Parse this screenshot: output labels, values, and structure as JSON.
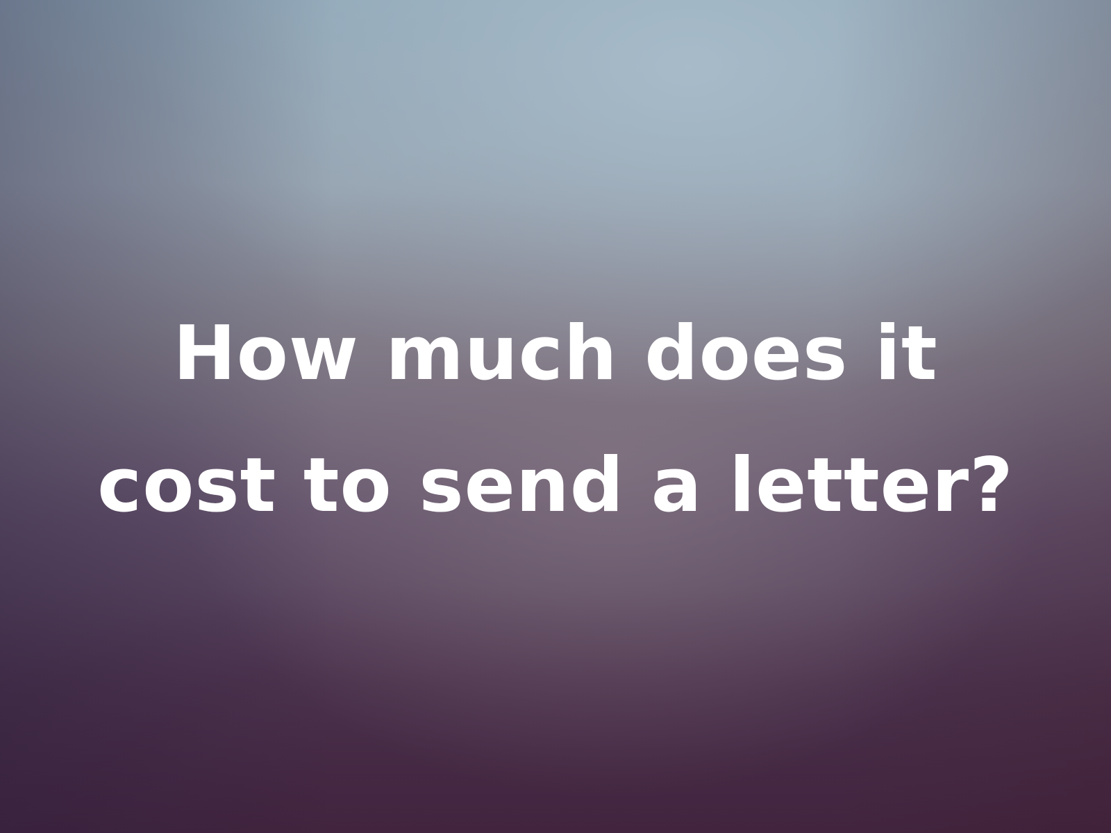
{
  "headline": {
    "line1": "How much does it",
    "line2": "cost to send a letter?"
  },
  "colors": {
    "text": "#ffffff",
    "background_top": "#8ea6b6",
    "background_bottom": "#3f2742"
  }
}
